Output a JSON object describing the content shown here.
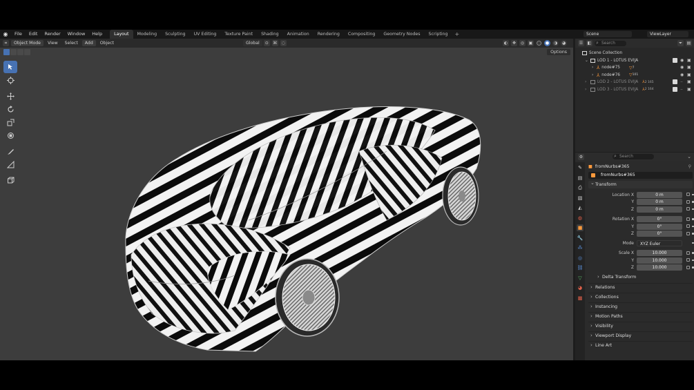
{
  "menu": [
    "File",
    "Edit",
    "Render",
    "Window",
    "Help"
  ],
  "workspaces": [
    "Layout",
    "Modeling",
    "Sculpting",
    "UV Editing",
    "Texture Paint",
    "Shading",
    "Animation",
    "Rendering",
    "Compositing",
    "Geometry Nodes",
    "Scripting"
  ],
  "active_workspace": "Layout",
  "scene": "Scene",
  "view_layer": "ViewLayer",
  "viewport": {
    "mode": "Object Mode",
    "menus": [
      "View",
      "Select",
      "Add",
      "Object"
    ],
    "transform_orientation": "Global",
    "options_label": "Options"
  },
  "outliner": {
    "search_placeholder": "Search",
    "rows": [
      {
        "label": "Scene Collection",
        "type": "scene"
      },
      {
        "label": "LOD 1 - LOTUS EVIJA",
        "type": "collection",
        "checked": true
      },
      {
        "label": "node#75",
        "type": "mesh",
        "badge": "7"
      },
      {
        "label": "node#76",
        "type": "mesh",
        "badge": "101"
      },
      {
        "label": "LOD 2 - LOTUS EVIJA",
        "type": "collection",
        "checked": true,
        "dim": true,
        "badge": "2 165"
      },
      {
        "label": "LOD 3 - LOTUS EVIJA",
        "type": "collection",
        "checked": true,
        "dim": true,
        "badge": "2 164"
      }
    ]
  },
  "properties": {
    "search_placeholder": "Search",
    "object_title": "fromNurbs#365",
    "object_name": "fromNurbs#365",
    "transform_label": "Transform",
    "location": {
      "label": "Location X",
      "x": "0 m",
      "y": "0 m",
      "z": "0 m"
    },
    "rotation": {
      "label": "Rotation X",
      "x": "0°",
      "y": "0°",
      "z": "0°"
    },
    "mode": {
      "label": "Mode",
      "value": "XYZ Euler"
    },
    "scale": {
      "label": "Scale X",
      "x": "10.000",
      "y": "10.000",
      "z": "10.000"
    },
    "axis_y": "Y",
    "axis_z": "Z",
    "delta_transform": "Delta Transform",
    "panels": [
      "Relations",
      "Collections",
      "Instancing",
      "Motion Paths",
      "Visibility",
      "Viewport Display",
      "Line Art"
    ]
  },
  "colors": {
    "accent": "#4772b3",
    "object_orange": "#ff9a3c",
    "viewport_bg": "#3d3d3d"
  }
}
